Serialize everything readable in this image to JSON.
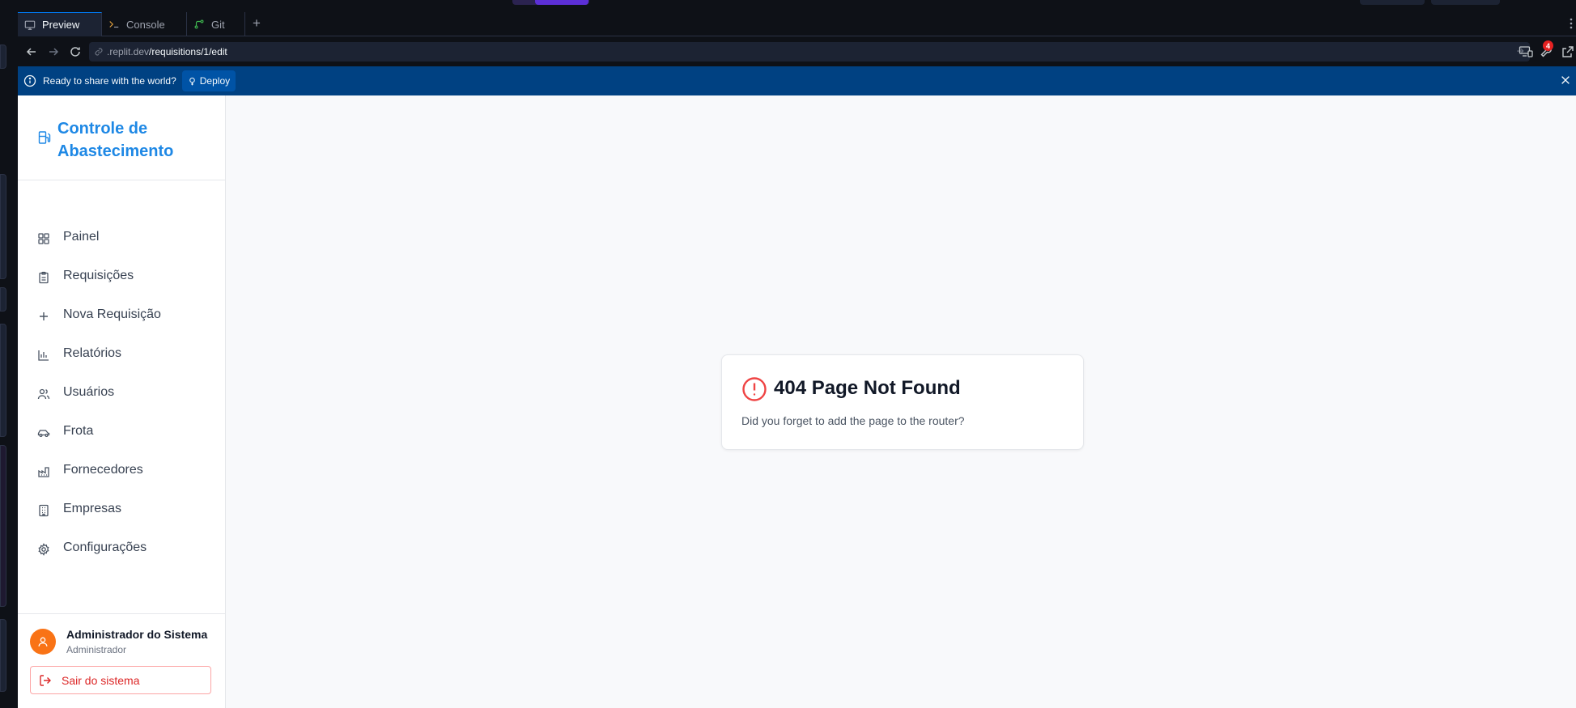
{
  "ide": {
    "tabs": [
      {
        "label": "Preview",
        "icon": "monitor-icon",
        "active": true
      },
      {
        "label": "Console",
        "icon": "terminal-icon",
        "active": false
      },
      {
        "label": "Git",
        "icon": "git-icon",
        "active": false
      }
    ],
    "add_tab": "+",
    "url_host": ".replit.dev",
    "url_path": "/requisitions/1/edit",
    "notification_count": "4"
  },
  "banner": {
    "text": "Ready to share with the world?",
    "deploy_label": "Deploy"
  },
  "app": {
    "brand": "Controle de Abastecimento",
    "brand_color": "#1e88e5",
    "nav": [
      {
        "label": "Painel",
        "icon": "grid-icon"
      },
      {
        "label": "Requisições",
        "icon": "clipboard-icon"
      },
      {
        "label": "Nova Requisição",
        "icon": "plus-icon"
      },
      {
        "label": "Relatórios",
        "icon": "bar-chart-icon"
      },
      {
        "label": "Usuários",
        "icon": "users-icon"
      },
      {
        "label": "Frota",
        "icon": "car-icon"
      },
      {
        "label": "Fornecedores",
        "icon": "factory-icon"
      },
      {
        "label": "Empresas",
        "icon": "building-icon"
      },
      {
        "label": "Configurações",
        "icon": "gear-icon"
      }
    ],
    "user": {
      "name": "Administrador do Sistema",
      "role": "Administrador"
    },
    "logout_label": "Sair do sistema"
  },
  "not_found": {
    "title": "404 Page Not Found",
    "message": "Did you forget to add the page to the router?"
  }
}
